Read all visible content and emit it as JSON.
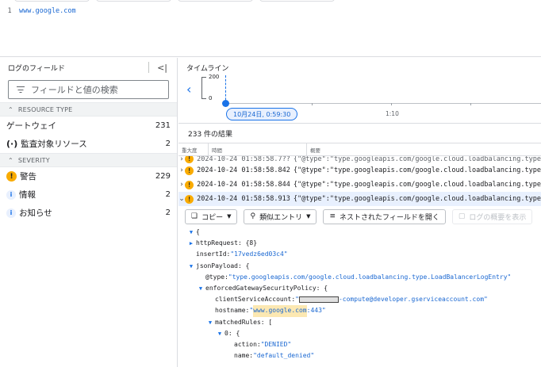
{
  "query": {
    "line_number": "1",
    "text": "www.google.com"
  },
  "sidebar": {
    "title": "ログのフィールド",
    "search_placeholder": "フィールドと値の検索",
    "resource_section": "RESOURCE TYPE",
    "resources": [
      {
        "label": "ゲートウェイ",
        "count": "231"
      },
      {
        "label": "監査対象リソース",
        "count": "2"
      }
    ],
    "severity_section": "SEVERITY",
    "severities": [
      {
        "label": "警告",
        "count": "229"
      },
      {
        "label": "情報",
        "count": "2"
      },
      {
        "label": "お知らせ",
        "count": "2"
      }
    ]
  },
  "timeline": {
    "title": "タイムライン",
    "y_max": "200",
    "y_min": "0",
    "tick_label": "1:10",
    "selected_time": "10月24日, 0:59:30"
  },
  "results": {
    "count": "233 件の結果",
    "columns": {
      "severity": "重大度",
      "time": "時間",
      "summary": "概要"
    },
    "partial_row": {
      "time": "2024-10-24 01:58:58.7??",
      "summary": "{\"@type\":\"type.googleapis.com/google.cloud.loadbalancing.type"
    },
    "rows": [
      {
        "time": "2024-10-24 01:58:58.842",
        "summary": "{\"@type\":\"type.googleapis.com/google.cloud.loadbalancing.type"
      },
      {
        "time": "2024-10-24 01:58:58.844",
        "summary": "{\"@type\":\"type.googleapis.com/google.cloud.loadbalancing.type"
      },
      {
        "time": "2024-10-24 01:58:58.913",
        "summary": "{\"@type\":\"type.googleapis.com/google.cloud.loadbalancing.type"
      }
    ]
  },
  "toolbar": {
    "copy": "コピー",
    "similar": "類似エントリ",
    "nested": "ネストされたフィールドを開く",
    "summary": "ログの概要を表示"
  },
  "entry": {
    "open_brace": "{",
    "http_request": "httpRequest: {8}",
    "insert_id_key": "insertId: ",
    "insert_id_val": "\"17vedz6ed03c4\"",
    "json_payload": "jsonPayload: {",
    "type_key": "@type: ",
    "type_val": "\"type.googleapis.com/google.cloud.loadbalancing.type.LoadBalancerLogEntry\"",
    "policy": "enforcedGatewaySecurityPolicy: {",
    "sa_key": "clientServiceAccount: ",
    "sa_prefix": "\"",
    "sa_suffix": "-compute@developer.gserviceaccount.com\"",
    "host_key": "hostname: ",
    "host_q": "\"",
    "host_hl": "www.google.com",
    "host_rest": ":443\"",
    "rules": "matchedRules: [",
    "rule0": "0: {",
    "action_key": "action: ",
    "action_val": "\"DENIED\"",
    "name_key": "name: ",
    "name_val": "\"default_denied\""
  }
}
